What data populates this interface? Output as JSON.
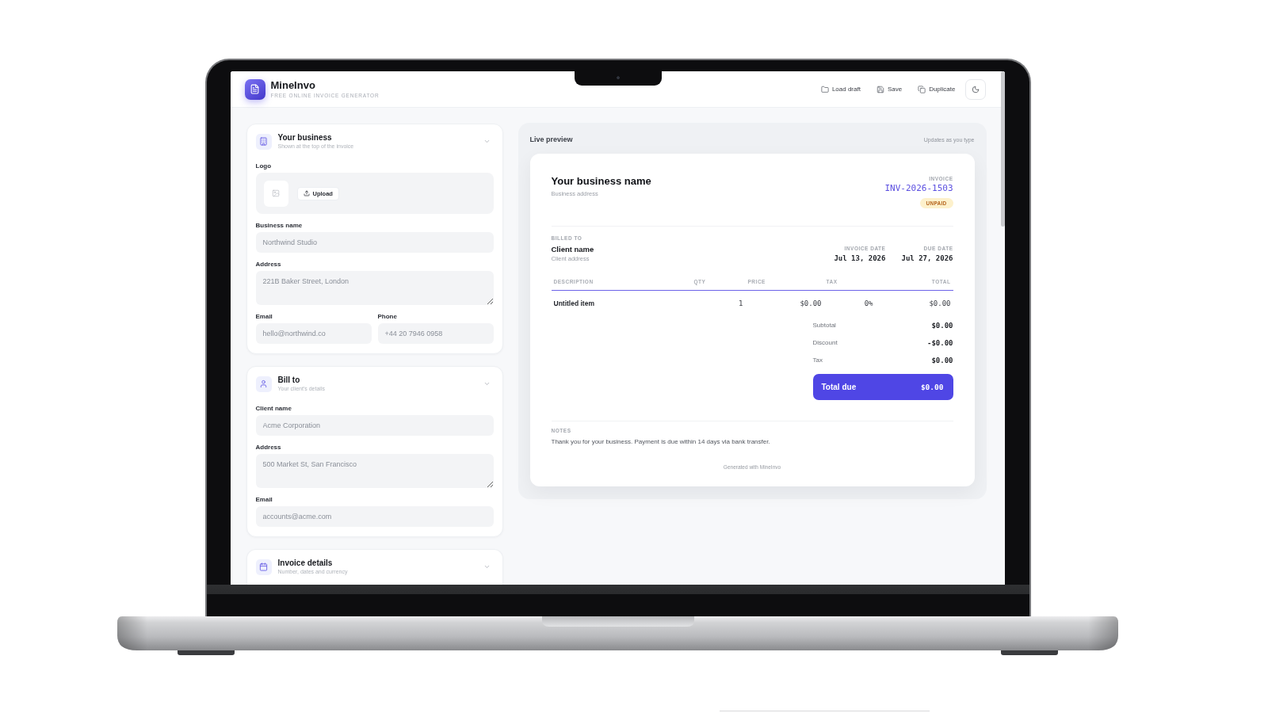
{
  "app": {
    "name": "MineInvo",
    "tagline": "FREE ONLINE INVOICE GENERATOR"
  },
  "toolbar": [
    {
      "kind": "load",
      "label": "Load draft"
    },
    {
      "kind": "save",
      "label": "Save"
    },
    {
      "kind": "duplicate",
      "label": "Duplicate"
    },
    {
      "kind": "theme"
    }
  ],
  "form": {
    "sections": [
      {
        "kind": "business",
        "title": "Your business",
        "subtitle": "Shown at the top of the invoice",
        "rows": [
          [
            {
              "kind": "logo",
              "label": "Logo",
              "button": "Upload"
            }
          ],
          [
            {
              "kind": "input",
              "label": "Business name",
              "placeholder": "Northwind Studio"
            }
          ],
          [
            {
              "kind": "textarea",
              "label": "Address",
              "placeholder": "221B Baker Street, London"
            }
          ],
          [
            {
              "kind": "input",
              "label": "Email",
              "placeholder": "hello@northwind.co"
            },
            {
              "kind": "input",
              "label": "Phone",
              "placeholder": "+44 20 7946 0958"
            }
          ]
        ]
      },
      {
        "kind": "client",
        "title": "Bill to",
        "subtitle": "Your client's details",
        "rows": [
          [
            {
              "kind": "input",
              "label": "Client name",
              "placeholder": "Acme Corporation"
            }
          ],
          [
            {
              "kind": "textarea",
              "label": "Address",
              "placeholder": "500 Market St, San Francisco"
            }
          ],
          [
            {
              "kind": "input",
              "label": "Email",
              "placeholder": "accounts@acme.com"
            }
          ]
        ]
      },
      {
        "kind": "details",
        "title": "Invoice details",
        "subtitle": "Number, dates and currency"
      }
    ]
  },
  "preview": {
    "title": "Live preview",
    "hint": "Updates as you type",
    "invoice": {
      "business_name": "Your business name",
      "business_address": "Business address",
      "label": "INVOICE",
      "number": "INV-2026-1503",
      "status": {
        "kind": "unpaid",
        "label": "UNPAID"
      },
      "billed_to": {
        "label": "BILLED TO",
        "name": "Client name",
        "address": "Client address"
      },
      "dates": [
        {
          "label": "INVOICE DATE",
          "value": "Jul 13, 2026"
        },
        {
          "label": "DUE DATE",
          "value": "Jul 27, 2026"
        }
      ],
      "table": {
        "columns": [
          "DESCRIPTION",
          "QTY",
          "PRICE",
          "TAX",
          "TOTAL"
        ],
        "rows": [
          [
            "Untitled item",
            "1",
            "$0.00",
            "0%",
            "$0.00"
          ]
        ]
      },
      "totals": [
        {
          "label": "Subtotal",
          "value": "$0.00"
        },
        {
          "label": "Discount",
          "value": "-$0.00"
        },
        {
          "label": "Tax",
          "value": "$0.00"
        }
      ],
      "total_due": {
        "label": "Total due",
        "value": "$0.00"
      },
      "notes": {
        "label": "NOTES",
        "text": "Thank you for your business. Payment is due within 14 days via bank transfer."
      },
      "footer": "Generated with MineInvo"
    }
  }
}
